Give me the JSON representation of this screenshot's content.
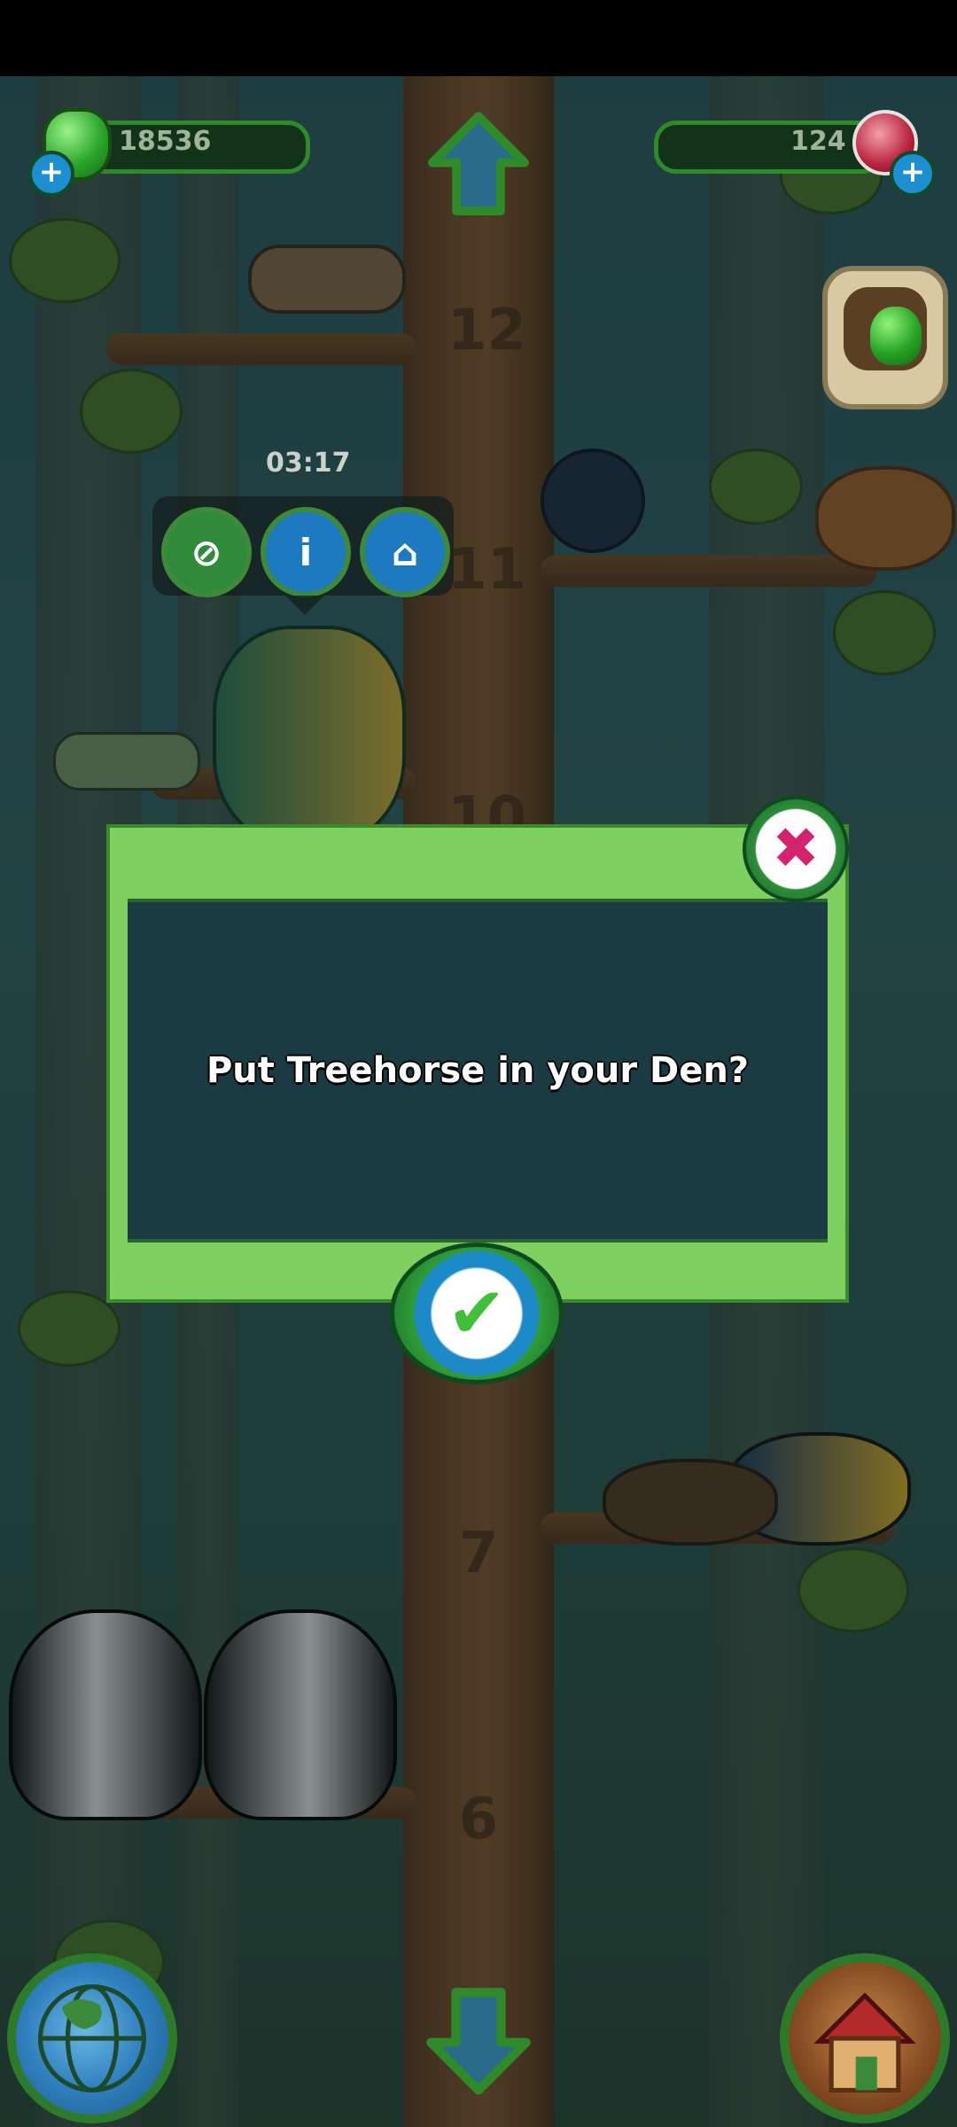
{
  "hud": {
    "gems_green": "18536",
    "gems_red": "124"
  },
  "tree": {
    "levels": [
      "12",
      "11",
      "10",
      "7",
      "6"
    ]
  },
  "popup": {
    "timer": "03:17",
    "action_buttons": [
      "net-icon",
      "info-icon",
      "den-icon"
    ]
  },
  "dialog": {
    "message": "Put Treehorse in your Den?"
  },
  "colors": {
    "dialog_frame": "#7ed160",
    "dialog_panel": "#1b3b43",
    "close_accent": "#d4226e",
    "confirm_accent": "#3fbf3a"
  }
}
